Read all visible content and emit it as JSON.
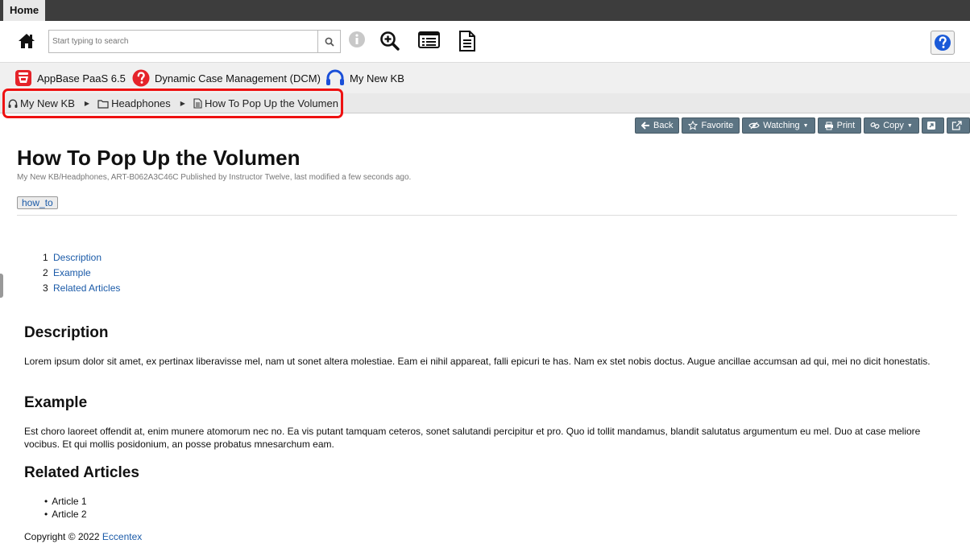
{
  "window": {
    "tab_label": "Home"
  },
  "toolbar": {
    "search_placeholder": "Start typing to search",
    "icons": [
      "home-icon",
      "search-icon",
      "info-icon",
      "zoom-in-icon",
      "list-icon",
      "document-icon",
      "help-icon"
    ]
  },
  "apps": [
    {
      "label": "AppBase PaaS 6.5",
      "icon": "appbase-icon",
      "color": "#e5232a"
    },
    {
      "label": "Dynamic Case Management (DCM)",
      "icon": "question-icon",
      "color": "#e5232a"
    },
    {
      "label": "My New KB",
      "icon": "headphones-icon",
      "color": "#1a4fd8"
    }
  ],
  "breadcrumb": {
    "items": [
      {
        "label": "My New KB",
        "icon": "headphones-icon"
      },
      {
        "label": "Headphones",
        "icon": "folder-icon"
      },
      {
        "label": "How To Pop Up the Volumen",
        "icon": "document-icon"
      }
    ],
    "highlight_color": "#ee1111"
  },
  "actions": {
    "back": "Back",
    "favorite": "Favorite",
    "watching": "Watching",
    "print": "Print",
    "copy": "Copy"
  },
  "article": {
    "title": "How To Pop Up the Volumen",
    "meta": "My New KB/Headphones, ART-B062A3C46C Published by Instructor Twelve, last modified a few seconds ago.",
    "tag": "how_to",
    "toc": [
      {
        "num": "1",
        "label": "Description"
      },
      {
        "num": "2",
        "label": "Example"
      },
      {
        "num": "3",
        "label": "Related Articles"
      }
    ],
    "description_heading": "Description",
    "description_text": "Lorem ipsum dolor sit amet, ex pertinax liberavisse mel, nam ut sonet altera molestiae. Eam ei nihil appareat, falli epicuri te has. Nam ex stet nobis doctus. Augue ancillae accumsan ad qui, mei no dicit honestatis.",
    "example_heading": "Example",
    "example_text": "Est choro laoreet offendit at, enim munere atomorum nec no. Ea vis putant tamquam ceteros, sonet salutandi percipitur et pro. Quo id tollit mandamus, blandit salutatus argumentum eu mel. Duo at case meliore vocibus. Et qui mollis posidonium, an posse probatus mnesarchum eam.",
    "related_heading": "Related Articles",
    "related": [
      "Article 1",
      "Article 2"
    ]
  },
  "footer": {
    "copyright": "Copyright © 2022",
    "company": "Eccentex"
  },
  "colors": {
    "action_button": "#5c7483",
    "link": "#1a5aa8",
    "topbar": "#3d3d3d"
  }
}
